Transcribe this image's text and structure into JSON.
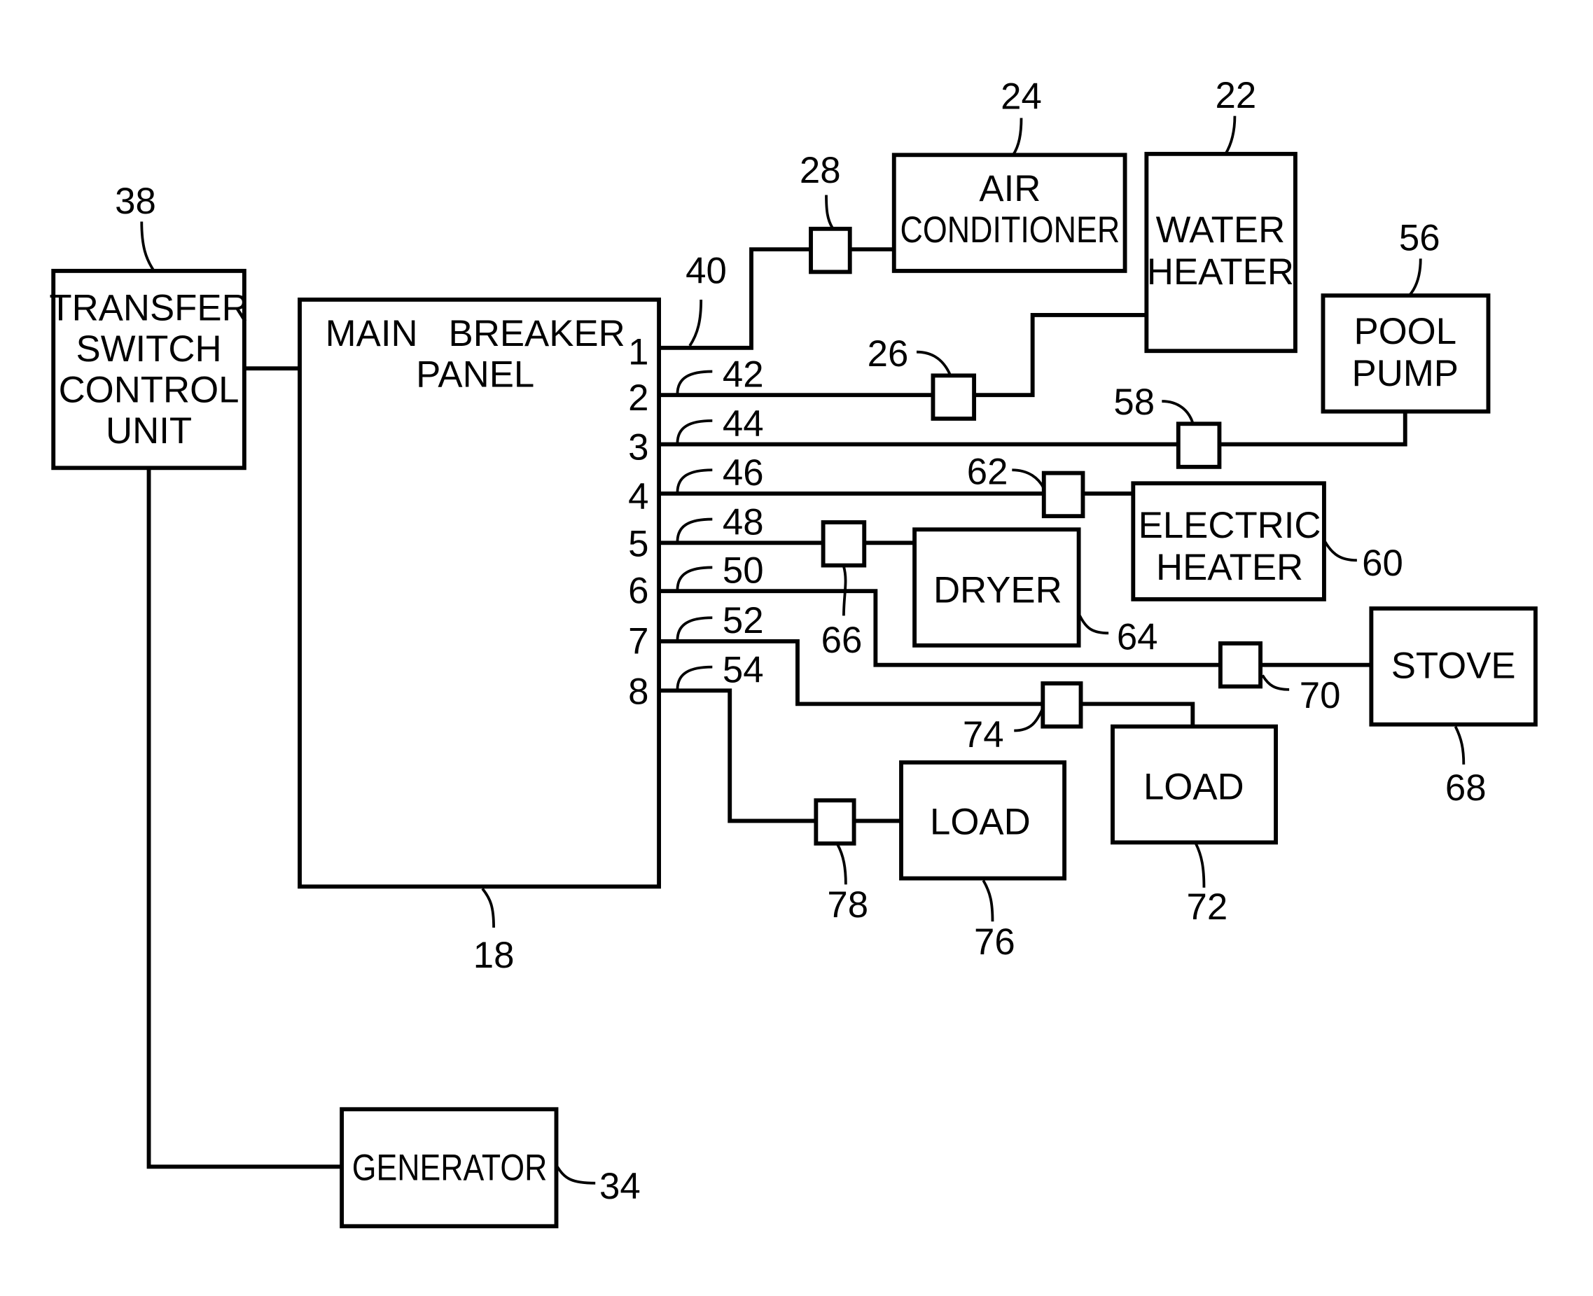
{
  "figure": {
    "components": {
      "transfer_switch": {
        "lines": [
          "TRANSFER",
          "SWITCH",
          "CONTROL",
          "UNIT"
        ],
        "ref": "38"
      },
      "main_panel": {
        "lines": [
          "MAIN   BREAKER",
          "PANEL"
        ],
        "ref": "18"
      },
      "generator": {
        "lines": [
          "GENERATOR"
        ],
        "ref": "34"
      },
      "air_conditioner": {
        "lines": [
          "AIR",
          "CONDITIONER"
        ],
        "ref": "24"
      },
      "water_heater": {
        "lines": [
          "WATER",
          "HEATER"
        ],
        "ref": "22"
      },
      "pool_pump": {
        "lines": [
          "POOL",
          "PUMP"
        ],
        "ref": "56"
      },
      "electric_heater": {
        "lines": [
          "ELECTRIC",
          "HEATER"
        ],
        "ref": "60"
      },
      "dryer": {
        "lines": [
          "DRYER"
        ],
        "ref": "64"
      },
      "stove": {
        "lines": [
          "STOVE"
        ],
        "ref": "68"
      },
      "load_72": {
        "lines": [
          "LOAD"
        ],
        "ref": "72"
      },
      "load_76": {
        "lines": [
          "LOAD"
        ],
        "ref": "76"
      }
    },
    "breakers": [
      {
        "number": "1",
        "circuit_ref": "40"
      },
      {
        "number": "2",
        "circuit_ref": "42"
      },
      {
        "number": "3",
        "circuit_ref": "44"
      },
      {
        "number": "4",
        "circuit_ref": "46"
      },
      {
        "number": "5",
        "circuit_ref": "48"
      },
      {
        "number": "6",
        "circuit_ref": "50"
      },
      {
        "number": "7",
        "circuit_ref": "52"
      },
      {
        "number": "8",
        "circuit_ref": "54"
      }
    ],
    "switch_refs": {
      "ac_switch": "28",
      "water_heater_switch": "26",
      "pool_pump_switch": "58",
      "electric_heater_switch": "62",
      "dryer_switch": "66",
      "stove_switch": "70",
      "load72_switch": "74",
      "load76_switch": "78"
    }
  }
}
